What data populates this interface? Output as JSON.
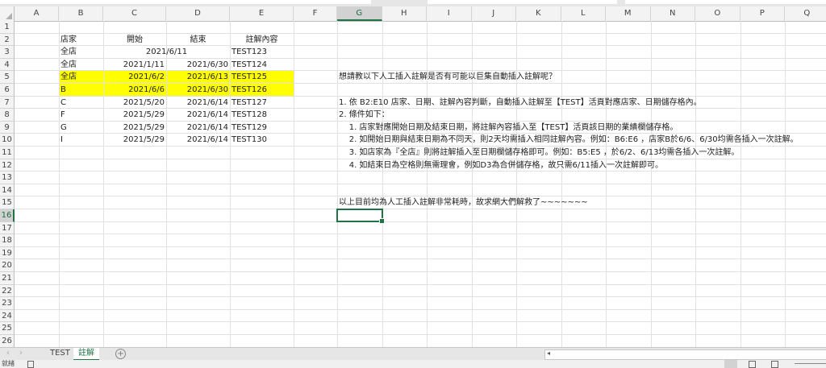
{
  "columns": [
    "A",
    "B",
    "C",
    "D",
    "E",
    "F",
    "G",
    "H",
    "I",
    "J",
    "K",
    "L",
    "M",
    "N",
    "O",
    "P",
    "Q"
  ],
  "selected_column": "G",
  "selected_row": 16,
  "row_count": 26,
  "highlight_color": "#ffff00",
  "accent_color": "#217346",
  "cells": [
    {
      "ref": "B2",
      "text": "店家",
      "align": "l"
    },
    {
      "ref": "C2",
      "text": "開始",
      "align": "c"
    },
    {
      "ref": "D2",
      "text": "結束",
      "align": "c"
    },
    {
      "ref": "E2",
      "text": "註解內容",
      "align": "c"
    },
    {
      "ref": "B3",
      "text": "全店",
      "align": "l"
    },
    {
      "ref": "C3",
      "text": "2021/6/11",
      "align": "merged-cd"
    },
    {
      "ref": "E3",
      "text": "TEST123",
      "align": "l"
    },
    {
      "ref": "B4",
      "text": "全店",
      "align": "l"
    },
    {
      "ref": "C4",
      "text": "2021/1/11",
      "align": "r"
    },
    {
      "ref": "D4",
      "text": "2021/6/30",
      "align": "r"
    },
    {
      "ref": "E4",
      "text": "TEST124",
      "align": "l"
    },
    {
      "ref": "B5",
      "text": "全店",
      "align": "l"
    },
    {
      "ref": "C5",
      "text": "2021/6/2",
      "align": "r"
    },
    {
      "ref": "D5",
      "text": "2021/6/13",
      "align": "r"
    },
    {
      "ref": "E5",
      "text": "TEST125",
      "align": "l"
    },
    {
      "ref": "B6",
      "text": "B",
      "align": "l"
    },
    {
      "ref": "C6",
      "text": "2021/6/6",
      "align": "r"
    },
    {
      "ref": "D6",
      "text": "2021/6/30",
      "align": "r"
    },
    {
      "ref": "E6",
      "text": "TEST126",
      "align": "l"
    },
    {
      "ref": "B7",
      "text": "C",
      "align": "l"
    },
    {
      "ref": "C7",
      "text": "2021/5/20",
      "align": "r"
    },
    {
      "ref": "D7",
      "text": "2021/6/14",
      "align": "r"
    },
    {
      "ref": "E7",
      "text": "TEST127",
      "align": "l"
    },
    {
      "ref": "B8",
      "text": "F",
      "align": "l"
    },
    {
      "ref": "C8",
      "text": "2021/5/29",
      "align": "r"
    },
    {
      "ref": "D8",
      "text": "2021/6/14",
      "align": "r"
    },
    {
      "ref": "E8",
      "text": "TEST128",
      "align": "l"
    },
    {
      "ref": "B9",
      "text": "G",
      "align": "l"
    },
    {
      "ref": "C9",
      "text": "2021/5/29",
      "align": "r"
    },
    {
      "ref": "D9",
      "text": "2021/6/14",
      "align": "r"
    },
    {
      "ref": "E9",
      "text": "TEST129",
      "align": "l"
    },
    {
      "ref": "B10",
      "text": "I",
      "align": "l"
    },
    {
      "ref": "C10",
      "text": "2021/5/29",
      "align": "r"
    },
    {
      "ref": "D10",
      "text": "2021/6/14",
      "align": "r"
    },
    {
      "ref": "E10",
      "text": "TEST130",
      "align": "l"
    },
    {
      "ref": "G5",
      "text": "想請教以下人工插入註解是否有可能以巨集自動插入註解呢？",
      "align": "l"
    },
    {
      "ref": "G7",
      "text": "1. 依 B2:E10 店家、日期、註解內容判斷，自動插入註解至【TEST】活頁對應店家、日期儲存格內。",
      "align": "l"
    },
    {
      "ref": "G8",
      "text": "2. 條件如下：",
      "align": "l"
    },
    {
      "ref": "G9",
      "text": "    1. 店家對應開始日期及結束日期，將註解內容插入至【TEST】活頁該日期的業績欄儲存格。",
      "align": "l"
    },
    {
      "ref": "G10",
      "text": "    2. 如開始日期與結束日期為不同天，則2天均需插入相同註解內容。例如：B6:E6 ，店家B於6/6、6/30均需各插入一次註解。",
      "align": "l"
    },
    {
      "ref": "G11",
      "text": "    3. 如店家為『全店』則將註解插入至日期欄儲存格即可。例如：B5:E5 ，於6/2、6/13均需各插入一次註解。",
      "align": "l"
    },
    {
      "ref": "G12",
      "text": "    4. 如結束日為空格則無需理會，例如D3為合併儲存格，故只需6/11插入一次註解即可。",
      "align": "l"
    },
    {
      "ref": "G15",
      "text": "以上目前均為人工插入註解非常耗時，故求網大們解救了~~~~~~~",
      "align": "l"
    }
  ],
  "highlighted_rows": [
    5,
    6
  ],
  "sheet_tabs": [
    {
      "label": "TEST",
      "active": false
    },
    {
      "label": "註解",
      "active": true
    }
  ],
  "add_sheet_icon": "plus-circle-icon",
  "status": {
    "mode": "就緒"
  }
}
